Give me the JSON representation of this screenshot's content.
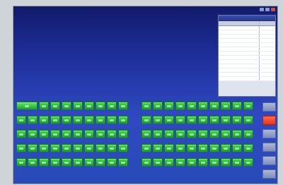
{
  "window": {
    "controls": [
      "minimize-icon",
      "maximize-icon",
      "close-icon"
    ],
    "accent_color": "#d84a3a"
  },
  "panel": {
    "columns": [
      "",
      ""
    ],
    "row_count": 13
  },
  "tiles": {
    "left_group": {
      "rows": 5,
      "columns": 10,
      "wide_first_tile_in_first_row": true
    },
    "right_group": {
      "rows": 5,
      "columns": 10
    },
    "color": "#2fb63c"
  },
  "side_buttons": {
    "count": 6,
    "active_index": 1,
    "active_color": "#e2361f"
  }
}
